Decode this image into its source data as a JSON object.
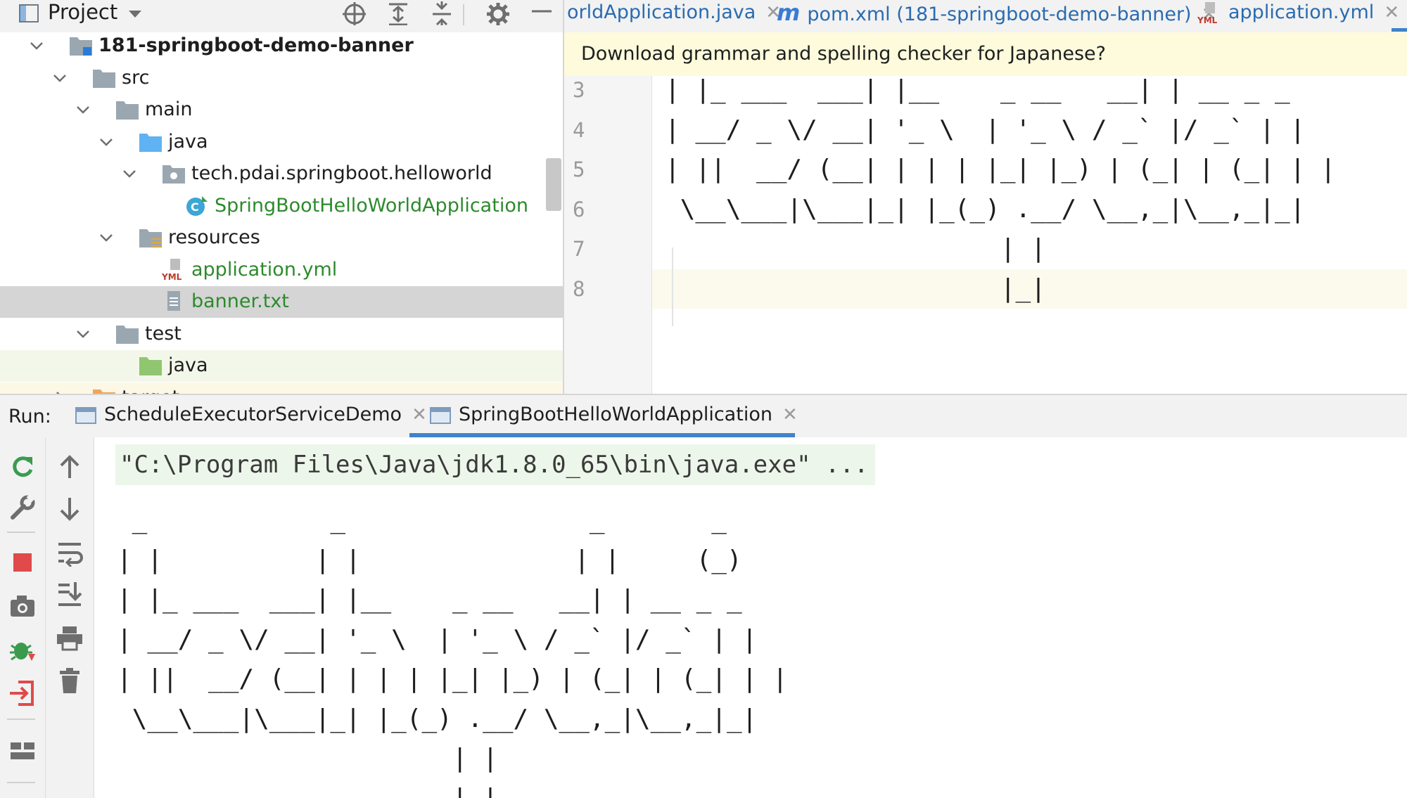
{
  "project_panel": {
    "title": "Project",
    "tree": [
      {
        "label": "181-springboot-demo-banner",
        "depth": 0,
        "expanded": true,
        "icon": "module-folder-icon",
        "style": "bold"
      },
      {
        "label": "src",
        "depth": 1,
        "expanded": true,
        "icon": "folder-icon"
      },
      {
        "label": "main",
        "depth": 2,
        "expanded": true,
        "icon": "folder-icon"
      },
      {
        "label": "java",
        "depth": 3,
        "expanded": true,
        "icon": "source-folder-icon"
      },
      {
        "label": "tech.pdai.springboot.helloworld",
        "depth": 4,
        "expanded": true,
        "icon": "package-icon"
      },
      {
        "label": "SpringBootHelloWorldApplication",
        "depth": 5,
        "icon": "spring-boot-class-icon",
        "style": "green"
      },
      {
        "label": "resources",
        "depth": 3,
        "expanded": true,
        "icon": "resources-folder-icon"
      },
      {
        "label": "application.yml",
        "depth": 4,
        "icon": "yml-file-icon",
        "style": "green"
      },
      {
        "label": "banner.txt",
        "depth": 4,
        "icon": "text-file-icon",
        "style": "green",
        "selected": true
      },
      {
        "label": "test",
        "depth": 2,
        "expanded": true,
        "icon": "folder-icon"
      },
      {
        "label": "java",
        "depth": 3,
        "icon": "test-source-folder-icon",
        "row": "test-src"
      },
      {
        "label": "target",
        "depth": 1,
        "expanded": false,
        "icon": "excluded-folder-icon",
        "row": "excluded"
      }
    ]
  },
  "editor": {
    "tabs": [
      {
        "label": "orldApplication.java",
        "icon": "none"
      },
      {
        "label": "pom.xml (181-springboot-demo-banner)",
        "icon": "maven-icon",
        "icon_text": "m"
      },
      {
        "label": "application.yml",
        "icon": "yml-file-icon"
      }
    ],
    "notification": "Download grammar and spelling checker for Japanese?",
    "lines": [
      {
        "num": "3",
        "text": "| |_ ___  ___| |__    _ __   __| | __ _ _"
      },
      {
        "num": "4",
        "text": "| __/ _ \\/ __| '_ \\  | '_ \\ / _` |/ _` | |"
      },
      {
        "num": "5",
        "text": "| ||  __/ (__| | | | |_| |_) | (_| | (_| | |"
      },
      {
        "num": "6",
        "text": " \\__\\___|\\___|_| |_(_) .__/ \\__,_|\\__,_|_|"
      },
      {
        "num": "7",
        "text": "                      | |"
      },
      {
        "num": "8",
        "text": "                      |_|"
      }
    ]
  },
  "run_panel": {
    "label": "Run:",
    "tabs": [
      {
        "label": "ScheduleExecutorServiceDemo",
        "active": false
      },
      {
        "label": "SpringBootHelloWorldApplication",
        "active": true
      }
    ],
    "console": {
      "command": "\"C:\\Program Files\\Java\\jdk1.8.0_65\\bin\\java.exe\" ...",
      "banner": " _            _                _       _\n| |          | |              | |     (_)\n| |_ ___  ___| |__    _ __   __| | __ _ _\n| __/ _ \\/ __| '_ \\  | '_ \\ / _` |/ _` | |\n| ||  __/ (__| | | | |_| |_) | (_| | (_| | |\n \\__\\___|\\___|_| |_(_) .__/ \\__,_|\\__,_|_|\n                      | |\n                      |_|"
    }
  },
  "colors": {
    "accent": "#4083c9",
    "link_blue": "#2a6bb0",
    "green_text": "#2d8a2d",
    "selection": "#d5d5d5",
    "notification_bg": "#fdfbdc",
    "stop_red": "#e04a4a"
  }
}
